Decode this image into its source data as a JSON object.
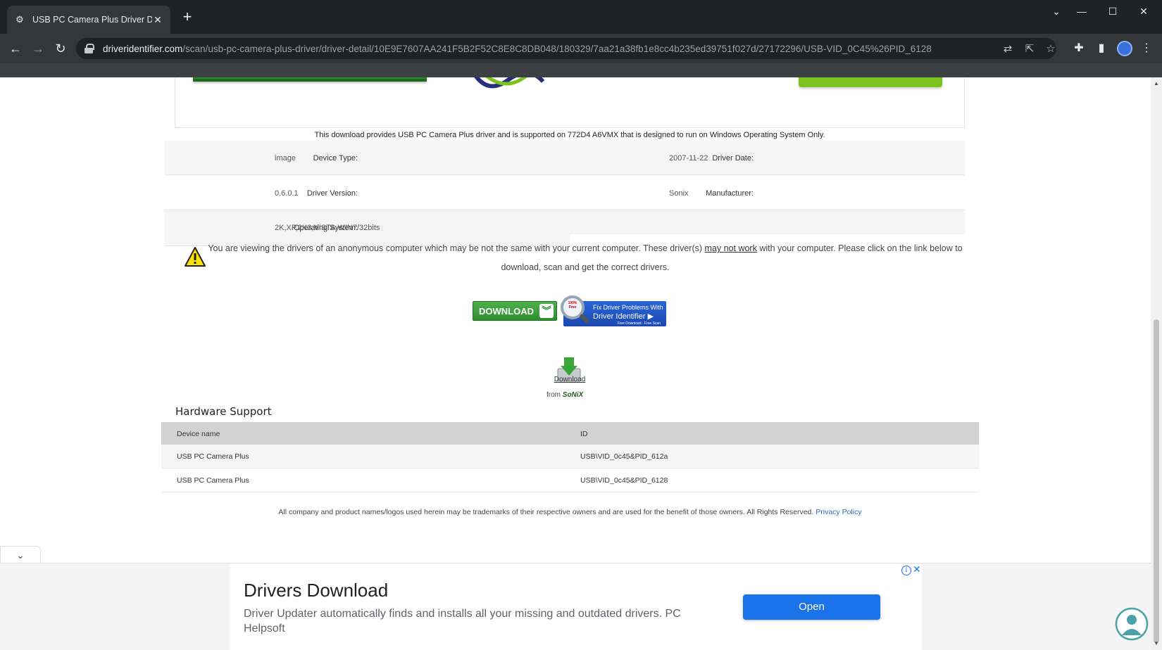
{
  "browser": {
    "tab_title": "USB PC Camera Plus Driver Down",
    "url_host": "driveridentifier.com",
    "url_path": "/scan/usb-pc-camera-plus-driver/driver-detail/10E9E7607AA241F5B2F52C8E8C8DB048/180329/7aa21a38fb1e8cc4b235ed39751f027d/27172296/USB-VID_0C45%26PID_6128"
  },
  "provides_text": "This download provides USB PC Camera Plus driver and is supported on 772D4 A6VMX that is designed to run on Windows Operating System Only.",
  "specs": {
    "device_type_label": "Device Type:",
    "device_type_value": "image",
    "driver_date_label": "Driver Date:",
    "driver_date_value": "2007-11-22",
    "driver_version_label": "Driver Version:",
    "driver_version_value": "0.6.0.1",
    "manufacturer_label": "Manufacturer:",
    "manufacturer_value": "Sonix",
    "os_label": "Operating System:",
    "os_value": "2K,XP,2K3,VISTA,WIN7/32bits"
  },
  "warning": {
    "before": "You are viewing the drivers of an anonymous computer which may be not the same with your current computer. These driver(s) ",
    "link": "may not work",
    "after": " with your computer. Please click on the link below to download, scan and get the correct drivers."
  },
  "download_button": "DOWNLOAD",
  "fix_button": {
    "badge": "100% Free",
    "line1": "Fix Driver Problems With",
    "line2": "Driver Identifier",
    "line3": "Free Download · Free Scan"
  },
  "download_box": {
    "label": "Download",
    "from": "from",
    "brand": "SoNiX"
  },
  "hardware": {
    "title": "Hardware Support",
    "col_name": "Device name",
    "col_id": "ID",
    "rows": [
      {
        "name": "USB PC Camera Plus",
        "id": "USB\\VID_0c45&PID_612a"
      },
      {
        "name": "USB PC Camera Plus",
        "id": "USB\\VID_0c45&PID_6128"
      }
    ]
  },
  "footer": {
    "text": "All company and product names/logos used herein may be trademarks of their respective owners and are used for the benefit of those owners. All Rights Reserved. ",
    "privacy_link": "Privacy Policy"
  },
  "ad": {
    "title": "Drivers Download",
    "description": "Driver Updater automatically finds and installs all your missing and outdated drivers. PC Helpsoft",
    "open_button": "Open"
  },
  "colors": {
    "chrome_dark": "#202124",
    "chrome_toolbar": "#35363a",
    "download_green": "#2f8f2f",
    "ad_blue": "#1a73e8"
  }
}
